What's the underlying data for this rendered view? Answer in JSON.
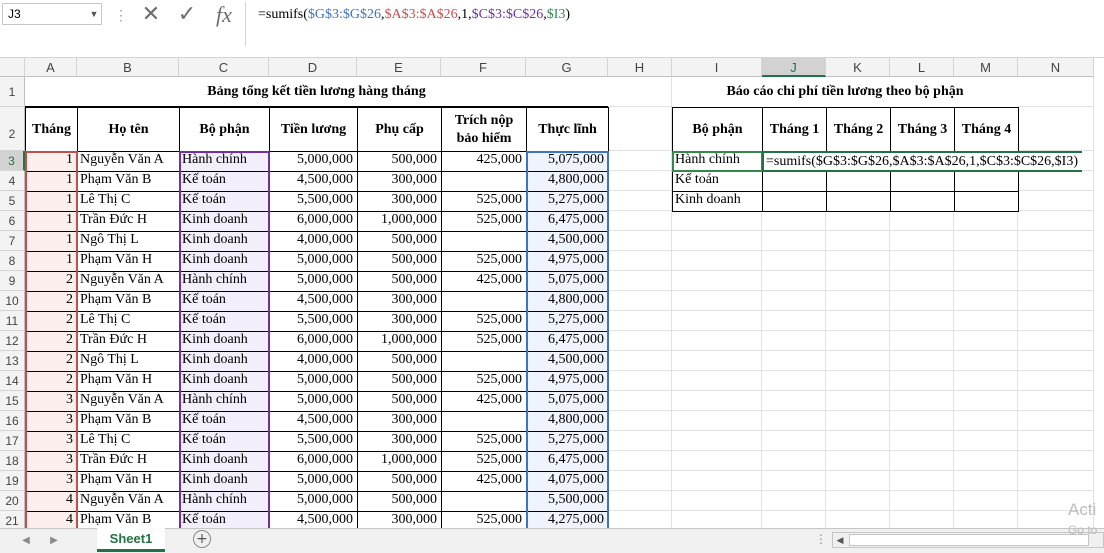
{
  "namebox": "J3",
  "formula_bar": {
    "icons": [
      "more-icon",
      "cancel-icon",
      "enter-icon",
      "function-icon"
    ],
    "formula_parts": [
      "=sumifs(",
      "$G$3:$G$26",
      ",",
      "$A$3:$A$26",
      ",1,",
      "$C$3:$C$26",
      ",",
      "$I3",
      ")"
    ]
  },
  "columns": [
    "A",
    "B",
    "C",
    "D",
    "E",
    "F",
    "G",
    "H",
    "I",
    "J",
    "K",
    "L",
    "M",
    "N"
  ],
  "selected_column": "J",
  "rows": [
    "1",
    "2",
    "3",
    "4",
    "5",
    "6",
    "7",
    "8",
    "9",
    "10",
    "11",
    "12",
    "13",
    "14",
    "15",
    "16",
    "17",
    "18",
    "19",
    "20",
    "21"
  ],
  "selected_row": "3",
  "main_title": "Bảng tổng kết tiền lương hàng tháng",
  "main_headers": [
    "Tháng",
    "Họ tên",
    "Bộ phận",
    "Tiền lương",
    "Phụ cấp",
    "Trích nộp bảo hiểm",
    "Thực lĩnh"
  ],
  "data_rows": [
    {
      "thang": "1",
      "ho_ten": "Nguyễn Văn A",
      "bo_phan": "Hành chính",
      "tien_luong": "5,000,000",
      "phu_cap": "500,000",
      "bao_hiem": "425,000",
      "thuc_linh": "5,075,000"
    },
    {
      "thang": "1",
      "ho_ten": "Phạm Văn B",
      "bo_phan": "Kế toán",
      "tien_luong": "4,500,000",
      "phu_cap": "300,000",
      "bao_hiem": "",
      "thuc_linh": "4,800,000"
    },
    {
      "thang": "1",
      "ho_ten": "Lê Thị C",
      "bo_phan": "Kế toán",
      "tien_luong": "5,500,000",
      "phu_cap": "300,000",
      "bao_hiem": "525,000",
      "thuc_linh": "5,275,000"
    },
    {
      "thang": "1",
      "ho_ten": "Trần Đức H",
      "bo_phan": "Kinh doanh",
      "tien_luong": "6,000,000",
      "phu_cap": "1,000,000",
      "bao_hiem": "525,000",
      "thuc_linh": "6,475,000"
    },
    {
      "thang": "1",
      "ho_ten": "Ngô Thị L",
      "bo_phan": "Kinh doanh",
      "tien_luong": "4,000,000",
      "phu_cap": "500,000",
      "bao_hiem": "",
      "thuc_linh": "4,500,000"
    },
    {
      "thang": "1",
      "ho_ten": "Phạm Văn H",
      "bo_phan": "Kinh doanh",
      "tien_luong": "5,000,000",
      "phu_cap": "500,000",
      "bao_hiem": "525,000",
      "thuc_linh": "4,975,000"
    },
    {
      "thang": "2",
      "ho_ten": "Nguyễn Văn A",
      "bo_phan": "Hành chính",
      "tien_luong": "5,000,000",
      "phu_cap": "500,000",
      "bao_hiem": "425,000",
      "thuc_linh": "5,075,000"
    },
    {
      "thang": "2",
      "ho_ten": "Phạm Văn B",
      "bo_phan": "Kế toán",
      "tien_luong": "4,500,000",
      "phu_cap": "300,000",
      "bao_hiem": "",
      "thuc_linh": "4,800,000"
    },
    {
      "thang": "2",
      "ho_ten": "Lê Thị C",
      "bo_phan": "Kế toán",
      "tien_luong": "5,500,000",
      "phu_cap": "300,000",
      "bao_hiem": "525,000",
      "thuc_linh": "5,275,000"
    },
    {
      "thang": "2",
      "ho_ten": "Trần Đức H",
      "bo_phan": "Kinh doanh",
      "tien_luong": "6,000,000",
      "phu_cap": "1,000,000",
      "bao_hiem": "525,000",
      "thuc_linh": "6,475,000"
    },
    {
      "thang": "2",
      "ho_ten": "Ngô Thị L",
      "bo_phan": "Kinh doanh",
      "tien_luong": "4,000,000",
      "phu_cap": "500,000",
      "bao_hiem": "",
      "thuc_linh": "4,500,000"
    },
    {
      "thang": "2",
      "ho_ten": "Phạm Văn H",
      "bo_phan": "Kinh doanh",
      "tien_luong": "5,000,000",
      "phu_cap": "500,000",
      "bao_hiem": "525,000",
      "thuc_linh": "4,975,000"
    },
    {
      "thang": "3",
      "ho_ten": "Nguyễn Văn A",
      "bo_phan": "Hành chính",
      "tien_luong": "5,000,000",
      "phu_cap": "500,000",
      "bao_hiem": "425,000",
      "thuc_linh": "5,075,000"
    },
    {
      "thang": "3",
      "ho_ten": "Phạm Văn B",
      "bo_phan": "Kế toán",
      "tien_luong": "4,500,000",
      "phu_cap": "300,000",
      "bao_hiem": "",
      "thuc_linh": "4,800,000"
    },
    {
      "thang": "3",
      "ho_ten": "Lê Thị C",
      "bo_phan": "Kế toán",
      "tien_luong": "5,500,000",
      "phu_cap": "300,000",
      "bao_hiem": "525,000",
      "thuc_linh": "5,275,000"
    },
    {
      "thang": "3",
      "ho_ten": "Trần Đức H",
      "bo_phan": "Kinh doanh",
      "tien_luong": "6,000,000",
      "phu_cap": "1,000,000",
      "bao_hiem": "525,000",
      "thuc_linh": "6,475,000"
    },
    {
      "thang": "3",
      "ho_ten": "Phạm Văn H",
      "bo_phan": "Kinh doanh",
      "tien_luong": "5,000,000",
      "phu_cap": "500,000",
      "bao_hiem": "425,000",
      "thuc_linh": "4,075,000"
    },
    {
      "thang": "4",
      "ho_ten": "Nguyễn Văn A",
      "bo_phan": "Hành chính",
      "tien_luong": "5,000,000",
      "phu_cap": "500,000",
      "bao_hiem": "",
      "thuc_linh": "5,500,000"
    },
    {
      "thang": "4",
      "ho_ten": "Phạm Văn B",
      "bo_phan": "Kế toán",
      "tien_luong": "4,500,000",
      "phu_cap": "300,000",
      "bao_hiem": "525,000",
      "thuc_linh": "4,275,000"
    }
  ],
  "report": {
    "title": "Báo cáo chi phí tiền lương theo bộ phận",
    "headers": [
      "Bộ phận",
      "Tháng 1",
      "Tháng 2",
      "Tháng 3",
      "Tháng 4"
    ],
    "departments": [
      "Hành chính",
      "Kế toán",
      "Kinh doanh"
    ],
    "editing_text": "=sumifs($G$3:$G$26,$A$3:$A$26,1,$C$3:$C$26,$I3)"
  },
  "sheet_tab": "Sheet1",
  "add_sheet": "+",
  "watermark": [
    "Acti",
    "Go to"
  ],
  "colors": {
    "excel_green": "#217346",
    "ref_blue": "#3e72c5",
    "ref_red": "#c0504d",
    "ref_purple": "#7030a0",
    "ref_green": "#33884b"
  }
}
